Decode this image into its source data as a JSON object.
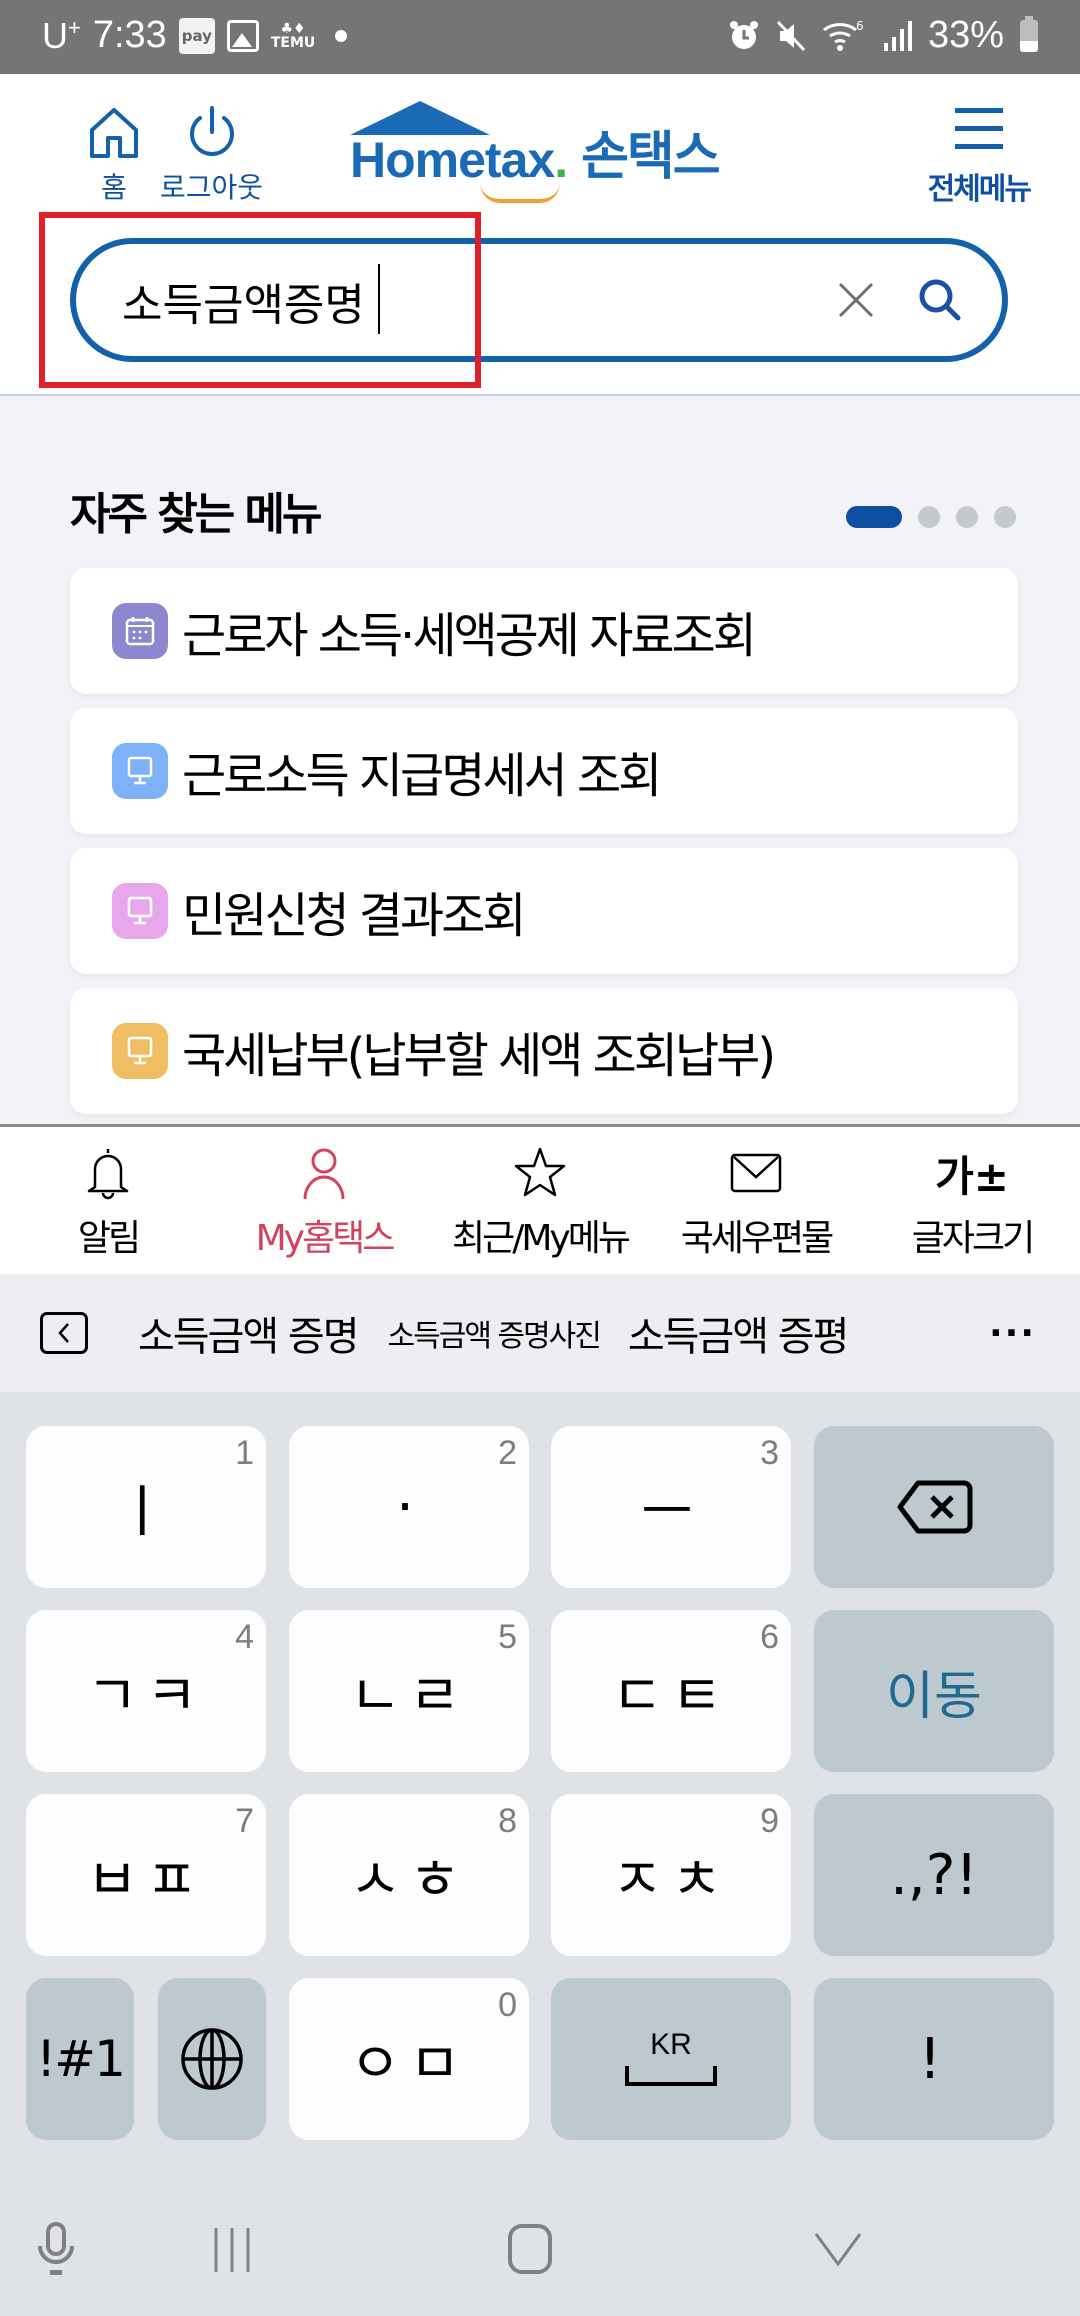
{
  "status_bar": {
    "carrier": "U",
    "carrier_sup": "+",
    "time": "7:33",
    "pay_label": "pay",
    "temu_label": "TEMU",
    "battery_percent": "33%"
  },
  "header": {
    "home_label": "홈",
    "logout_label": "로그아웃",
    "logo_en": "Hometax",
    "logo_kr": "손택스",
    "all_menu_label": "전체메뉴"
  },
  "search": {
    "value": "소득금액증명",
    "placeholder": ""
  },
  "favorites": {
    "title": "자주 찾는 메뉴",
    "page_count": 4,
    "active_page": 1,
    "items": [
      {
        "label": "근로자 소득·세액공제 자료조회",
        "icon": "calendar-icon",
        "color": "#8e87cf"
      },
      {
        "label": "근로소득 지급명세서 조회",
        "icon": "monitor-icon",
        "color": "#7fb1f9"
      },
      {
        "label": "민원신청 결과조회",
        "icon": "monitor-icon",
        "color": "#e8a7ec"
      },
      {
        "label": "국세납부(납부할 세액 조회납부)",
        "icon": "monitor-icon",
        "color": "#f0be62"
      }
    ]
  },
  "bottom_nav": {
    "items": [
      {
        "label": "알림",
        "icon": "bell-icon",
        "active": false
      },
      {
        "label": "My홈택스",
        "icon": "person-icon",
        "active": true
      },
      {
        "label": "최근/My메뉴",
        "icon": "star-icon",
        "active": false
      },
      {
        "label": "국세우편물",
        "icon": "mail-icon",
        "active": false
      },
      {
        "label": "글자크기",
        "icon": "font-size-icon",
        "active": false
      }
    ],
    "font_size_glyph": "가±"
  },
  "suggestions": {
    "items": [
      "소득금액 증명",
      "소득금액 증명사진",
      "소득금액 증평"
    ],
    "more": "···"
  },
  "keyboard": {
    "rows": [
      [
        {
          "glyph": "ㅣ",
          "num": "1"
        },
        {
          "glyph": "·",
          "num": "2"
        },
        {
          "glyph": "ㅡ",
          "num": "3"
        },
        {
          "glyph": "",
          "name": "backspace"
        }
      ],
      [
        {
          "glyph": "ㄱㅋ",
          "num": "4"
        },
        {
          "glyph": "ㄴㄹ",
          "num": "5"
        },
        {
          "glyph": "ㄷㅌ",
          "num": "6"
        },
        {
          "glyph": "이동",
          "name": "move"
        }
      ],
      [
        {
          "glyph": "ㅂㅍ",
          "num": "7"
        },
        {
          "glyph": "ㅅㅎ",
          "num": "8"
        },
        {
          "glyph": "ㅈㅊ",
          "num": "9"
        },
        {
          "glyph": ".,?!",
          "name": "punctuation"
        }
      ],
      [
        {
          "glyph": "!#1",
          "name": "symbols"
        },
        {
          "glyph": "",
          "name": "language"
        },
        {
          "glyph": "ㅇㅁ",
          "num": "0"
        },
        {
          "glyph": "KR",
          "name": "space"
        },
        {
          "glyph": "!",
          "name": "exclaim"
        }
      ]
    ]
  },
  "colors": {
    "brand_blue": "#1461ab",
    "accent_pink": "#d4405f",
    "highlight_red": "#e02028",
    "content_bg": "#f1f3f8",
    "keyboard_bg": "#dfe3e7"
  }
}
